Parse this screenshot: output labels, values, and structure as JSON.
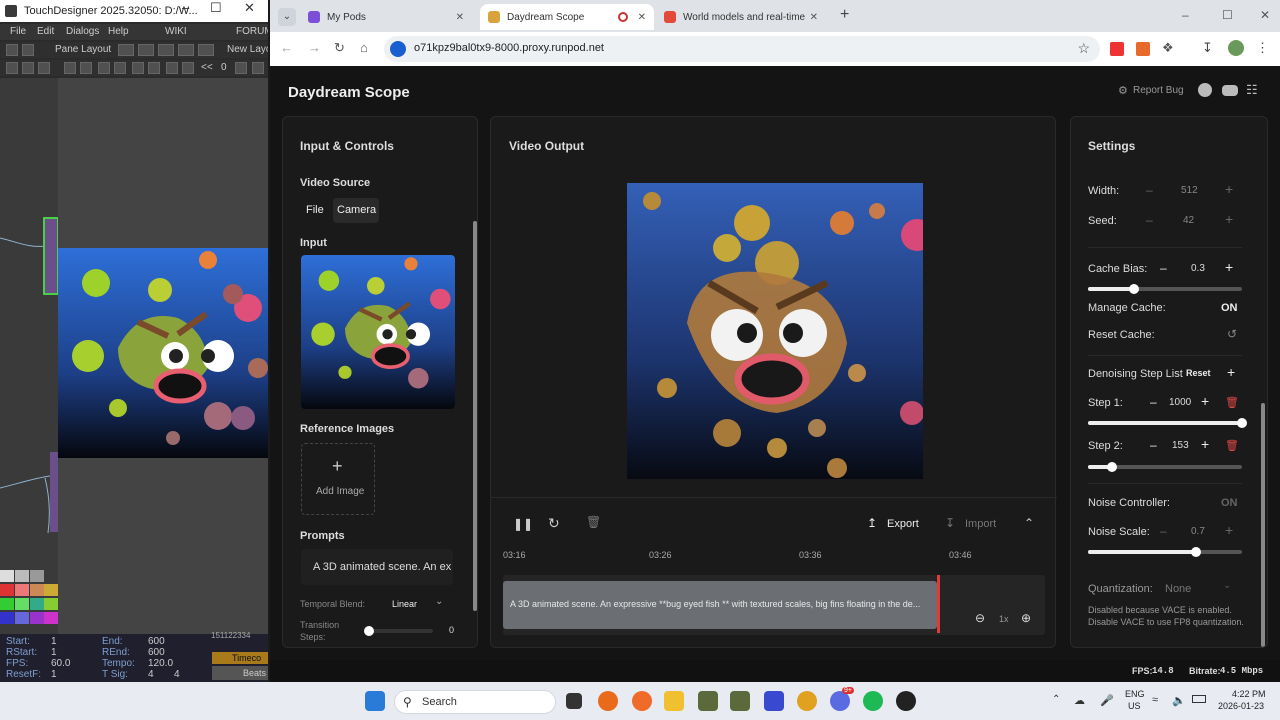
{
  "touchdesigner": {
    "title": "TouchDesigner 2025.32050: D:/W...",
    "menu": [
      "File",
      "Edit",
      "Dialogs",
      "Help",
      "WIKI",
      "FORUM"
    ],
    "pane_layout": "Pane Layout",
    "new_layout": "New Layo",
    "toolbar_value": "0",
    "toolbar_arrows": "<<",
    "bottom": {
      "start_label": "Start:",
      "start": "1",
      "end_label": "End:",
      "end": "600",
      "rstart_label": "RStart:",
      "rstart": "1",
      "rend_label": "REnd:",
      "rend": "600",
      "fps_label": "FPS:",
      "fps": "60.0",
      "tempo_label": "Tempo:",
      "tempo": "120.0",
      "resetf_label": "ResetF:",
      "resetf": "1",
      "tsig_label": "T Sig:",
      "tsig1": "4",
      "tsig2": "4",
      "timecode": "Timeco",
      "beats": "Beats",
      "ruler": "151122334"
    }
  },
  "browser": {
    "tabs": [
      {
        "label": "My Pods",
        "color": "#7b4fd6"
      },
      {
        "label": "Daydream Scope",
        "color": "#d9a23a"
      },
      {
        "label": "World models and real-time AI",
        "color": "#e34a3a"
      }
    ],
    "url": "o71kpz9bal0tx9-8000.proxy.runpod.net"
  },
  "app": {
    "title": "Daydream Scope",
    "report_bug": "Report Bug",
    "input_panel": {
      "title": "Input & Controls",
      "video_source": "Video Source",
      "source_file": "File",
      "source_camera": "Camera",
      "input_label": "Input",
      "reference_images": "Reference Images",
      "add_image": "Add Image",
      "prompts": "Prompts",
      "prompt_text": "A 3D animated scene. An ex",
      "temporal_blend": "Temporal Blend:",
      "temporal_blend_value": "Linear",
      "transition_steps": "Transition Steps:",
      "transition_steps_value": "0",
      "transition_steps_fraction": 0
    },
    "video_panel": {
      "title": "Video Output",
      "export": "Export",
      "import": "Import",
      "timeline_ticks": [
        "03:16",
        "03:26",
        "03:36",
        "03:46"
      ],
      "clip_text": "A 3D animated scene. An expressive **bug eyed fish ** with textured scales, big fins floating in the de...",
      "zoom": "1x"
    },
    "settings": {
      "title": "Settings",
      "width_label": "Width:",
      "width": "512",
      "seed_label": "Seed:",
      "seed": "42",
      "cache_bias_label": "Cache Bias:",
      "cache_bias": "0.3",
      "cache_bias_fraction": 0.3,
      "manage_cache_label": "Manage Cache:",
      "manage_cache": "ON",
      "reset_cache_label": "Reset Cache:",
      "denoise_label": "Denoising Step List",
      "denoise_reset": "Reset",
      "step1_label": "Step 1:",
      "step1": "1000",
      "step1_fraction": 1.0,
      "step2_label": "Step 2:",
      "step2": "153",
      "step2_fraction": 0.153,
      "noise_controller_label": "Noise Controller:",
      "noise_controller": "ON",
      "noise_scale_label": "Noise Scale:",
      "noise_scale": "0.7",
      "noise_scale_fraction": 0.7,
      "quantization_label": "Quantization:",
      "quantization": "None",
      "quant_note": "Disabled because VACE is enabled. Disable VACE to use FP8 quantization."
    },
    "status": {
      "fps_label": "FPS:",
      "fps": "14.8",
      "bitrate_label": "Bitrate:",
      "bitrate": "4.5 Mbps"
    }
  },
  "taskbar": {
    "search": "Search",
    "lang1": "ENG",
    "lang2": "US",
    "time": "4:22 PM",
    "date": "2026-01-23",
    "badge": "9+"
  }
}
